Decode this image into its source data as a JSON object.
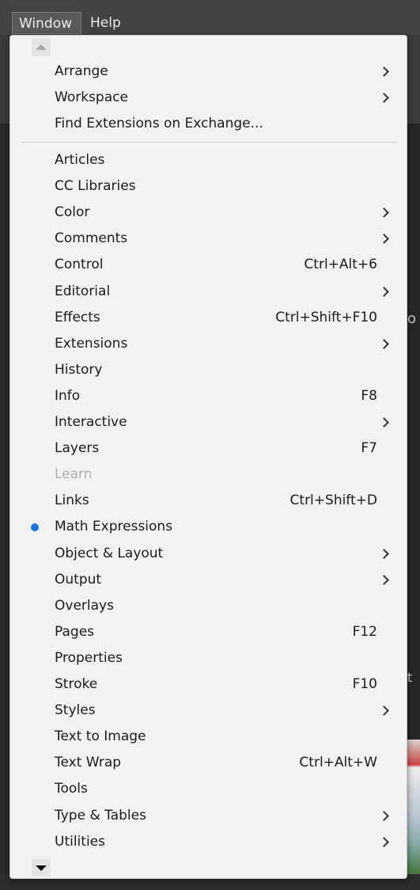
{
  "menubar": {
    "window_label": "Window",
    "help_label": "Help"
  },
  "menu": {
    "top_items": [
      {
        "label": "Arrange",
        "shortcut": "",
        "submenu": true
      },
      {
        "label": "Workspace",
        "shortcut": "",
        "submenu": true
      },
      {
        "label": "Find Extensions on Exchange...",
        "shortcut": "",
        "submenu": false
      }
    ],
    "items": [
      {
        "label": "Articles",
        "shortcut": "",
        "submenu": false
      },
      {
        "label": "CC Libraries",
        "shortcut": "",
        "submenu": false
      },
      {
        "label": "Color",
        "shortcut": "",
        "submenu": true
      },
      {
        "label": "Comments",
        "shortcut": "",
        "submenu": true
      },
      {
        "label": "Control",
        "shortcut": "Ctrl+Alt+6",
        "submenu": false
      },
      {
        "label": "Editorial",
        "shortcut": "",
        "submenu": true
      },
      {
        "label": "Effects",
        "shortcut": "Ctrl+Shift+F10",
        "submenu": false
      },
      {
        "label": "Extensions",
        "shortcut": "",
        "submenu": true
      },
      {
        "label": "History",
        "shortcut": "",
        "submenu": false
      },
      {
        "label": "Info",
        "shortcut": "F8",
        "submenu": false
      },
      {
        "label": "Interactive",
        "shortcut": "",
        "submenu": true
      },
      {
        "label": "Layers",
        "shortcut": "F7",
        "submenu": false
      },
      {
        "label": "Learn",
        "shortcut": "",
        "submenu": false,
        "disabled": true
      },
      {
        "label": "Links",
        "shortcut": "Ctrl+Shift+D",
        "submenu": false
      },
      {
        "label": "Math Expressions",
        "shortcut": "",
        "submenu": false,
        "checked": true
      },
      {
        "label": "Object & Layout",
        "shortcut": "",
        "submenu": true
      },
      {
        "label": "Output",
        "shortcut": "",
        "submenu": true
      },
      {
        "label": "Overlays",
        "shortcut": "",
        "submenu": false
      },
      {
        "label": "Pages",
        "shortcut": "F12",
        "submenu": false
      },
      {
        "label": "Properties",
        "shortcut": "",
        "submenu": false
      },
      {
        "label": "Stroke",
        "shortcut": "F10",
        "submenu": false
      },
      {
        "label": "Styles",
        "shortcut": "",
        "submenu": true
      },
      {
        "label": "Text to Image",
        "shortcut": "",
        "submenu": false
      },
      {
        "label": "Text Wrap",
        "shortcut": "Ctrl+Alt+W",
        "submenu": false
      },
      {
        "label": "Tools",
        "shortcut": "",
        "submenu": false
      },
      {
        "label": "Type & Tables",
        "shortcut": "",
        "submenu": true
      },
      {
        "label": "Utilities",
        "shortcut": "",
        "submenu": true
      }
    ]
  },
  "background": {
    "edge_glyph_1": "o",
    "edge_glyph_2": "t"
  },
  "colors": {
    "accent_dot": "#1473e6",
    "menu_bg": "#f2f2f2",
    "menubar_bg": "#434343"
  },
  "icons": {
    "scroll_up": "arrow-up-icon",
    "scroll_down": "arrow-down-icon",
    "submenu": "chevron-right-icon",
    "checked": "dot-icon"
  }
}
